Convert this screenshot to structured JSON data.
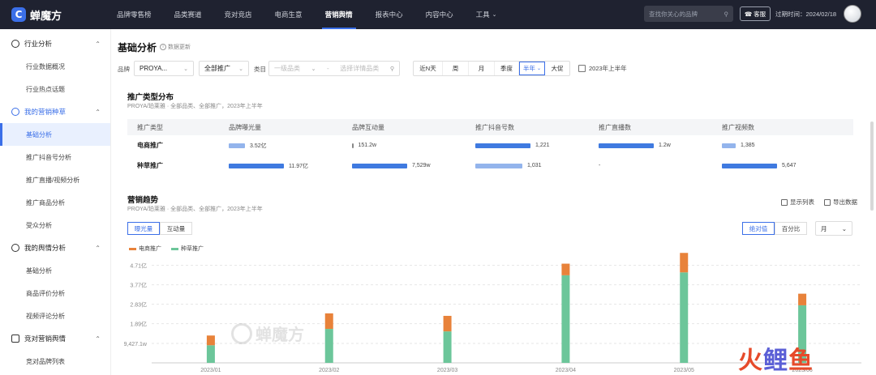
{
  "brand": {
    "name": "蝉魔方",
    "mark": "C"
  },
  "nav": [
    {
      "label": "品牌零售榜",
      "active": false
    },
    {
      "label": "品类赛道",
      "active": false
    },
    {
      "label": "竞对竞店",
      "active": false
    },
    {
      "label": "电商生意",
      "active": false
    },
    {
      "label": "营销舆情",
      "active": true
    },
    {
      "label": "报表中心",
      "active": false
    },
    {
      "label": "内容中心",
      "active": false
    },
    {
      "label": "工具",
      "active": false
    }
  ],
  "header": {
    "search_placeholder": "查找你关心的品牌",
    "service_label": "客服",
    "expire_text": "过期时间：2024/02/18"
  },
  "sidebar": [
    {
      "group": "行业分析",
      "color": "dark",
      "items": [
        "行业数据概况",
        "行业热点话题"
      ]
    },
    {
      "group": "我的营销种草",
      "color": "blue",
      "items": [
        "基础分析",
        "推广抖音号分析",
        "推广直播/视频分析",
        "推广商品分析",
        "受众分析"
      ]
    },
    {
      "group": "我的舆情分析",
      "color": "dark",
      "items": [
        "基础分析",
        "商品评价分析",
        "视频评论分析"
      ]
    },
    {
      "group": "竞对营销舆情",
      "color": "dark",
      "items": [
        "竞对品牌列表"
      ]
    }
  ],
  "page": {
    "title": "基础分析",
    "update_label": "数据更新"
  },
  "filters": {
    "brand_label": "品牌",
    "brand_value": "PROYA...",
    "promo_value": "全部推广",
    "category_label": "类目",
    "category_placeholder": "一级品类",
    "separator": "-",
    "product_placeholder": "选择详情品类",
    "periods": [
      "近N天",
      "周",
      "月",
      "季度",
      "半年",
      "大促"
    ],
    "active_period": "半年",
    "date_range": "2023年上半年"
  },
  "dist": {
    "title": "推广类型分布",
    "subtitle": "PROYA/珀莱雅 · 全部品类、全部推广，2023年上半年",
    "headers": [
      "推广类型",
      "品牌曝光量",
      "品牌互动量",
      "推广抖音号数",
      "推广直播数",
      "推广视频数"
    ],
    "rows": [
      {
        "name": "电商推广",
        "cells": [
          {
            "text": "3.52亿",
            "frac": 0.29,
            "light": true
          },
          {
            "text": "151.2w",
            "frac": 0.0,
            "light": false
          },
          {
            "text": "1,221",
            "frac": 1.0,
            "light": false
          },
          {
            "text": "1.2w",
            "frac": 1.0,
            "light": false
          },
          {
            "text": "1,385",
            "frac": 0.25,
            "light": true
          }
        ]
      },
      {
        "name": "种草推广",
        "cells": [
          {
            "text": "11.97亿",
            "frac": 1.0,
            "light": false
          },
          {
            "text": "7,529w",
            "frac": 1.0,
            "light": false
          },
          {
            "text": "1,031",
            "frac": 0.85,
            "light": true
          },
          {
            "text": "-",
            "frac": 0.0,
            "light": false
          },
          {
            "text": "5,647",
            "frac": 1.0,
            "light": false
          }
        ]
      }
    ]
  },
  "trend": {
    "title": "营销趋势",
    "subtitle": "PROYA/珀莱雅 · 全部品类、全部推广，2023年上半年",
    "show_list": "显示列表",
    "export": "导出数据",
    "metric_tabs": [
      "曝光量",
      "互动量"
    ],
    "active_metric": "曝光量",
    "value_tabs": [
      "绝对值",
      "百分比"
    ],
    "active_value": "绝对值",
    "granularity": "月"
  },
  "colors": {
    "ecom": "#e8823a",
    "seed": "#6cc69a",
    "accent": "#3b6fe8"
  },
  "chart_data": {
    "type": "bar",
    "stacked": true,
    "categories": [
      "2023/01",
      "2023/02",
      "2023/03",
      "2023/04",
      "2023/05",
      "2023/06"
    ],
    "series": [
      {
        "name": "电商推广",
        "values": [
          0.47,
          0.75,
          0.75,
          0.56,
          0.94,
          0.56
        ]
      },
      {
        "name": "种草推广",
        "values": [
          0.85,
          1.64,
          1.52,
          4.23,
          4.37,
          2.78
        ]
      }
    ],
    "yticks": [
      "4.71亿",
      "3.77亿",
      "2.83亿",
      "1.89亿",
      "9,427.1w"
    ],
    "ytick_values": [
      4.71,
      3.77,
      2.83,
      1.89,
      0.94
    ],
    "ylim": [
      0,
      5.32
    ],
    "unit": "亿",
    "grid": true,
    "legend": "top-left"
  },
  "corner": {
    "a": "火",
    "b": "鲤",
    "c": "鱼"
  }
}
